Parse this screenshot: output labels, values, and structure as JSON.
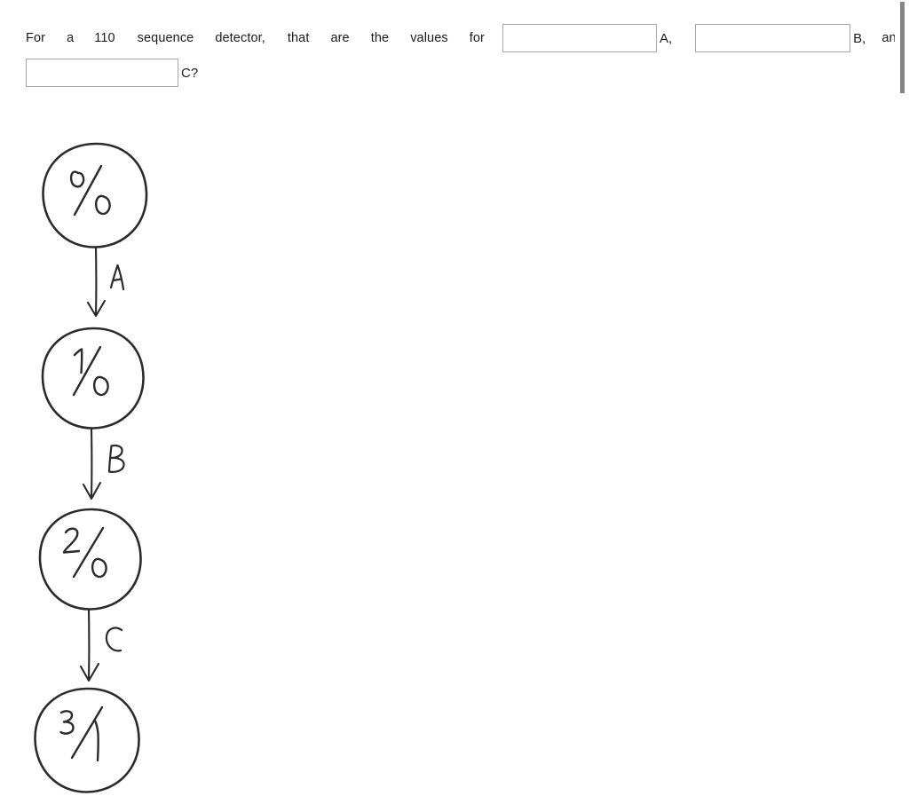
{
  "question": {
    "line1_words": [
      "For",
      "a",
      "110",
      "sequence",
      "detector,",
      "that",
      "are",
      "the",
      "values",
      "for"
    ],
    "full_text": "For a 110 sequence detector, that are the values for ___ A, ___ B, and ___ C?",
    "label_a": "A,",
    "label_b": "B,",
    "label_and": "and",
    "label_c": "C?"
  },
  "inputs": {
    "field_a": {
      "value": "",
      "placeholder": ""
    },
    "field_b": {
      "value": "",
      "placeholder": ""
    },
    "field_c": {
      "value": "",
      "placeholder": ""
    }
  },
  "diagram": {
    "kind": "hand-drawn state diagram",
    "description": "Four circular states connected top-to-bottom by labeled arrows",
    "states": [
      {
        "id": "s0",
        "label": "0/0",
        "numerator": "0",
        "denominator": "0"
      },
      {
        "id": "s1",
        "label": "1/0",
        "numerator": "1",
        "denominator": "0"
      },
      {
        "id": "s2",
        "label": "2/0",
        "numerator": "2",
        "denominator": "0"
      },
      {
        "id": "s3",
        "label": "3/1",
        "numerator": "3",
        "denominator": "1"
      }
    ],
    "transitions": [
      {
        "from": "s0",
        "to": "s1",
        "label": "A"
      },
      {
        "from": "s1",
        "to": "s2",
        "label": "B"
      },
      {
        "from": "s2",
        "to": "s3",
        "label": "C"
      }
    ]
  },
  "scrollbar": {
    "orientation": "vertical",
    "thumb_position": "top"
  },
  "colors": {
    "page_background": "#ffffff",
    "text": "#1b1b1b",
    "input_border": "#a8a8a8",
    "ink": "#2b2b2b",
    "scrollbar_thumb": "#868686"
  }
}
